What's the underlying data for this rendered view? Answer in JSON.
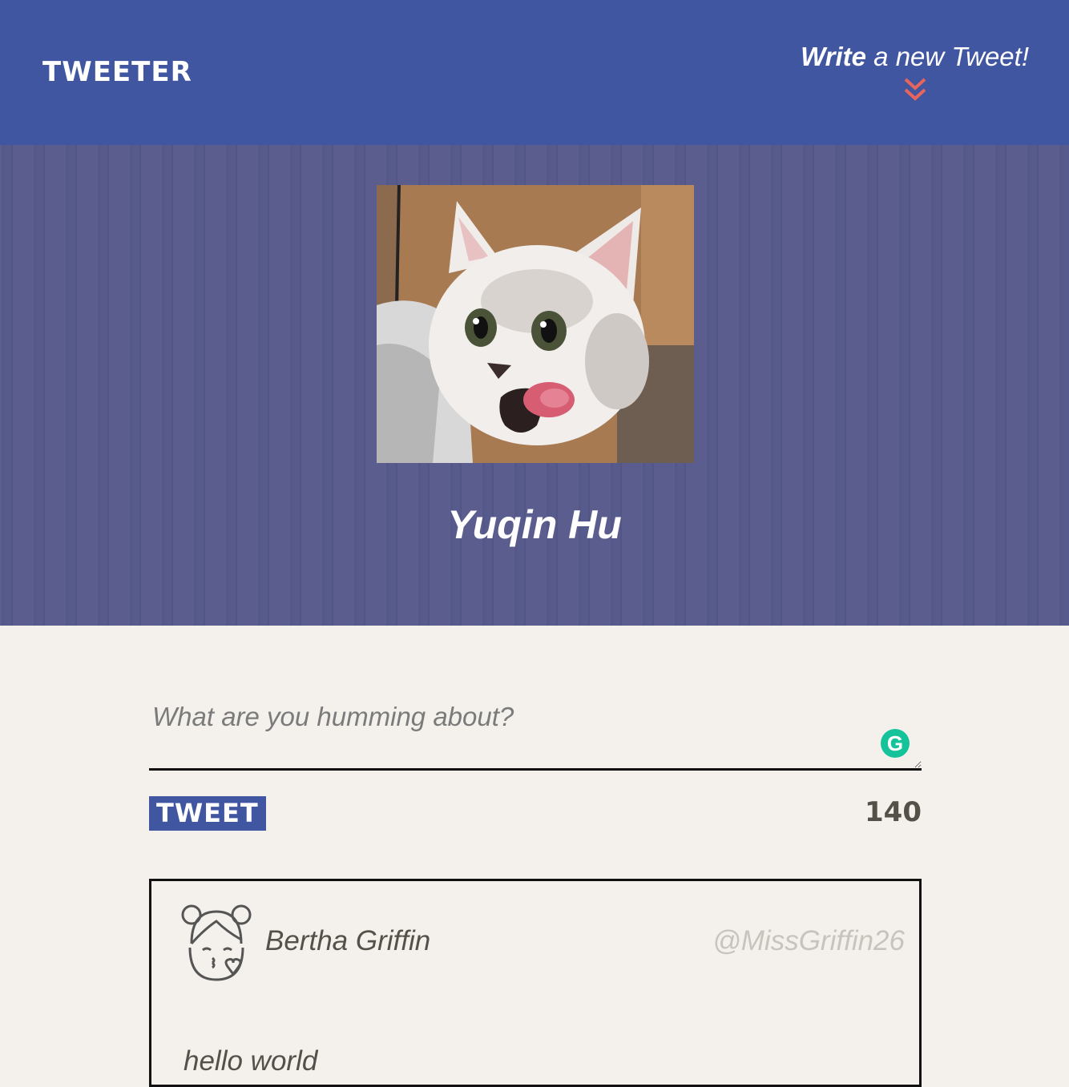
{
  "nav": {
    "brand": "TWEETER",
    "compose_strong": "Write",
    "compose_rest": " a new Tweet!",
    "compose_icon": "double-chevron-down-icon",
    "accent_color": "#e8655b"
  },
  "profile": {
    "avatar": "cat-photo",
    "name": "Yuqin Hu"
  },
  "composer": {
    "placeholder": "What are you humming about?",
    "value": "",
    "grammarly_icon": "G",
    "button_label": "TWEET",
    "counter": "140"
  },
  "tweets": [
    {
      "avatar_icon": "girl-face-icon",
      "author": "Bertha Griffin",
      "handle": "@MissGriffin26",
      "text": "hello world"
    }
  ],
  "colors": {
    "nav_bg": "#4056a1",
    "header_bg": "#575a8c",
    "page_bg": "#f4f1ec",
    "text": "#545149"
  }
}
